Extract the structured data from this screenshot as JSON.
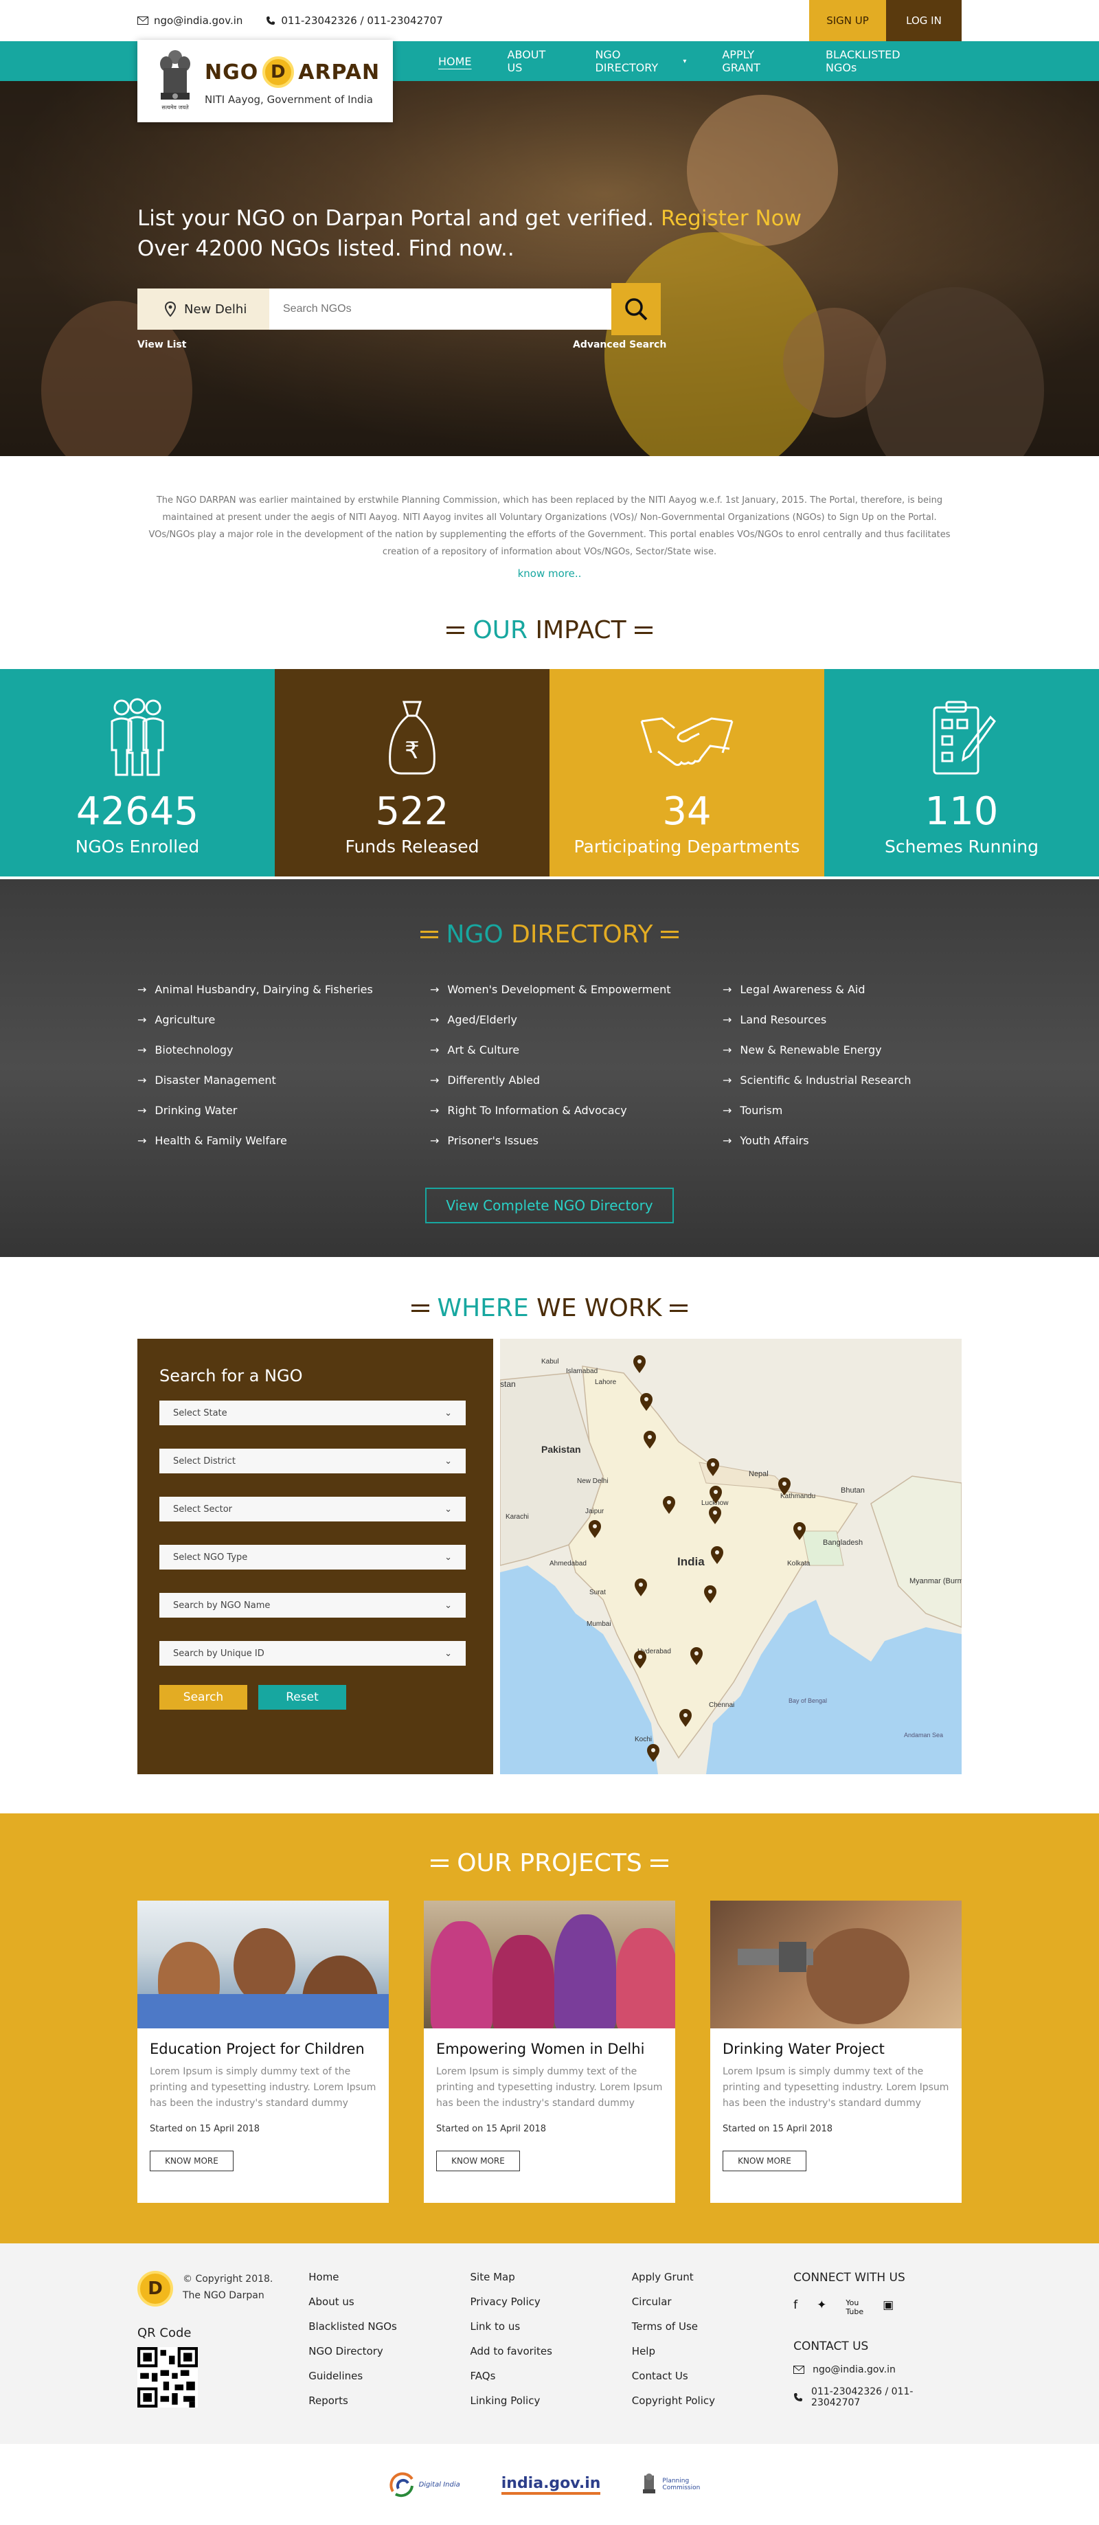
{
  "topbar": {
    "email": "ngo@india.gov.in",
    "phone": "011-23042326 / 011-23042707",
    "signup": "SIGN UP",
    "login": "LOG IN"
  },
  "brand": {
    "title_left": "NGO",
    "title_letter": "D",
    "title_right": "ARPAN",
    "subtitle": "NITI Aayog, Government of India"
  },
  "nav": [
    {
      "label": "HOME"
    },
    {
      "label": "ABOUT US"
    },
    {
      "label": "NGO DIRECTORY"
    },
    {
      "label": "APPLY GRANT"
    },
    {
      "label": "BLACKLISTED NGOs"
    }
  ],
  "hero": {
    "line1": "List your NGO on Darpan Portal and get verified.",
    "line1_link": "Register Now",
    "line2": "Over 42000 NGOs listed. Find now..",
    "location": "New Delhi",
    "search_placeholder": "Search NGOs",
    "view_list": "View List",
    "advanced_search": "Advanced Search"
  },
  "intro": {
    "text": "The NGO DARPAN was earlier maintained by erstwhile Planning Commission, which has been replaced by the NITI Aayog w.e.f. 1st January, 2015. The Portal, therefore, is being maintained at present under the aegis of NITI Aayog. NITI Aayog invites all Voluntary Organizations (VOs)/ Non-Governmental Organizations (NGOs) to Sign Up on the Portal. VOs/NGOs play a major role in the development of the nation by supplementing the efforts of the Government. This portal enables VOs/NGOs to enrol centrally and thus facilitates creation of a repository of information about VOs/NGOs, Sector/State wise.",
    "know_more": "know more.."
  },
  "impact": {
    "heading_a": "OUR",
    "heading_b": "IMPACT",
    "stats": [
      {
        "value": "42645",
        "label": "NGOs Enrolled",
        "icon": "people-icon"
      },
      {
        "value": "522",
        "label": "Funds Released",
        "icon": "money-bag-icon"
      },
      {
        "value": "34",
        "label": "Participating Departments",
        "icon": "handshake-icon"
      },
      {
        "value": "110",
        "label": "Schemes Running",
        "icon": "clipboard-icon"
      }
    ]
  },
  "directory": {
    "heading_a": "NGO",
    "heading_b": "DIRECTORY",
    "items": [
      "Animal Husbandry, Dairying & Fisheries",
      "Women's Development & Empowerment",
      "Legal Awareness & Aid",
      "Agriculture",
      "Aged/Elderly",
      "Land Resources",
      "Biotechnology",
      "Art & Culture",
      "New & Renewable Energy",
      "Disaster Management",
      "Differently Abled",
      "Scientific & Industrial Research",
      "Drinking Water",
      "Right To Information & Advocacy",
      "Tourism",
      "Health & Family Welfare",
      "Prisoner's Issues",
      "Youth Affairs"
    ],
    "button": "View Complete NGO Directory"
  },
  "work": {
    "heading_a": "WHERE",
    "heading_b": "WE WORK",
    "panel_title": "Search for a NGO",
    "selects": [
      "Select State",
      "Select District",
      "Select Sector",
      "Select NGO Type",
      "Search by NGO Name",
      "Search by Unique ID"
    ],
    "search_btn": "Search",
    "reset_btn": "Reset",
    "map_labels": {
      "pakistan": "Pakistan",
      "india": "India",
      "nepal": "Nepal",
      "bhutan": "Bhutan",
      "bangladesh": "Bangladesh",
      "myanmar": "Myanmar (Burma)",
      "new_delhi": "New Delhi",
      "mumbai": "Mumbai",
      "chennai": "Chennai",
      "hyderabad": "Hyderabad",
      "karachi": "Karachi",
      "lahore": "Lahore",
      "kabul": "Kabul",
      "islamabad": "Islamabad",
      "jaipur": "Jaipur",
      "lucknow": "Lucknow",
      "kolkata": "Kolkata",
      "kathmandu": "Kathmandu",
      "ahmedabad": "Ahmedabad",
      "surat": "Surat",
      "kochi": "Kochi",
      "stan": "stan",
      "bay": "Bay of Bengal",
      "andaman": "Andaman Sea"
    }
  },
  "projects": {
    "heading": "OUR PROJECTS",
    "cards": [
      {
        "title": "Education Project for Children",
        "desc": "Lorem Ipsum is simply dummy text of the printing and typesetting industry. Lorem Ipsum has been the industry's standard dummy",
        "date": "Started on 15 April 2018",
        "button": "KNOW MORE"
      },
      {
        "title": "Empowering Women in Delhi",
        "desc": "Lorem Ipsum is simply dummy text of the printing and typesetting industry. Lorem Ipsum has been the industry's standard dummy",
        "date": "Started on 15 April 2018",
        "button": "KNOW MORE"
      },
      {
        "title": "Drinking Water Project",
        "desc": "Lorem Ipsum is simply dummy text of the printing and typesetting industry. Lorem Ipsum has been the industry's standard dummy",
        "date": "Started on 15 April 2018",
        "button": "KNOW MORE"
      }
    ]
  },
  "footer": {
    "copyright_1": "© Copyright 2018.",
    "copyright_2": "The NGO Darpan",
    "qr_label": "QR Code",
    "col1": [
      "Home",
      "About us",
      "Blacklisted NGOs",
      "NGO Directory",
      "Guidelines",
      "Reports"
    ],
    "col2": [
      "Site Map",
      "Privacy Policy",
      "Link to us",
      "Add to favorites",
      "FAQs",
      "Linking Policy"
    ],
    "col3": [
      "Apply Grunt",
      "Circular",
      "Terms of Use",
      "Help",
      "Contact Us",
      "Copyright Policy"
    ],
    "connect": "CONNECT WITH US",
    "contact": "CONTACT US",
    "email": "ngo@india.gov.in",
    "phone": "011-23042326 / 011-23042707",
    "partners": [
      "Digital India",
      "india.gov.in",
      "Planning Commission"
    ]
  },
  "colors": {
    "teal": "#17a7a0",
    "brown": "#553810",
    "gold": "#e3ac23"
  }
}
